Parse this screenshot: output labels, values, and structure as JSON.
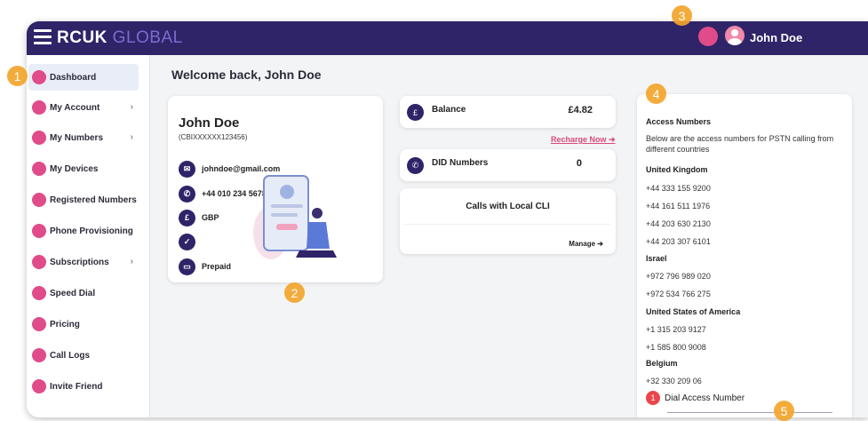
{
  "header": {
    "logo_main": "RCUK",
    "logo_sub": "GLOBAL",
    "user_name": "John Doe"
  },
  "sidebar": {
    "items": [
      {
        "label": "Dashboard",
        "icon": "user-circle-icon",
        "chevron": ""
      },
      {
        "label": "My Account",
        "icon": "account-icon",
        "chevron": "›"
      },
      {
        "label": "My Numbers",
        "icon": "hash-icon",
        "chevron": "›"
      },
      {
        "label": "My Devices",
        "icon": "devices-icon",
        "chevron": ""
      },
      {
        "label": "Registered Numbers",
        "icon": "phone-icon",
        "chevron": ""
      },
      {
        "label": "Phone Provisioning",
        "icon": "wrench-icon",
        "chevron": ""
      },
      {
        "label": "Subscriptions",
        "icon": "refresh-icon",
        "chevron": "›"
      },
      {
        "label": "Speed Dial",
        "icon": "speed-dial-icon",
        "chevron": ""
      },
      {
        "label": "Pricing",
        "icon": "price-tag-icon",
        "chevron": ""
      },
      {
        "label": "Call Logs",
        "icon": "phone-log-icon",
        "chevron": ""
      },
      {
        "label": "Invite Friend",
        "icon": "invite-icon",
        "chevron": ""
      }
    ]
  },
  "main": {
    "welcome": "Welcome back, John Doe",
    "profile": {
      "name": "John Doe",
      "id": "(CBIXXXXXX123456)",
      "email": "johndoe@gmail.com",
      "phone": "+44 010 234 5678",
      "currency": "GBP",
      "plan": "Prepaid"
    },
    "balance": {
      "label": "Balance",
      "value": "£4.82",
      "recharge": "Recharge Now ➔"
    },
    "did": {
      "label": "DID Numbers",
      "value": "0"
    },
    "calls": {
      "title": "Calls with Local CLI",
      "manage": "Manage ➔"
    },
    "access": {
      "title": "Access Numbers",
      "desc": "Below are the access numbers for PSTN calling from different countries",
      "countries": [
        {
          "name": "United Kingdom",
          "numbers": [
            "+44 333 155 9200",
            "+44 161 511 1976",
            "+44 203 630 2130",
            "+44 203 307 6101"
          ]
        },
        {
          "name": "Israel",
          "numbers": [
            "+972 796 989 020",
            "+972 534 766 275"
          ]
        },
        {
          "name": "United States of America",
          "numbers": [
            "+1 315 203 9127",
            "+1 585 800 9008"
          ]
        },
        {
          "name": "Belgium",
          "numbers": [
            "+32 330 209 06"
          ]
        }
      ],
      "dial_badge": "1",
      "dial_label": "Dial Access Number"
    }
  },
  "badges": [
    "1",
    "2",
    "3",
    "4",
    "5"
  ],
  "colors": {
    "primary": "#2f2468",
    "accent": "#e04b8a",
    "badge": "#f3a52c"
  }
}
